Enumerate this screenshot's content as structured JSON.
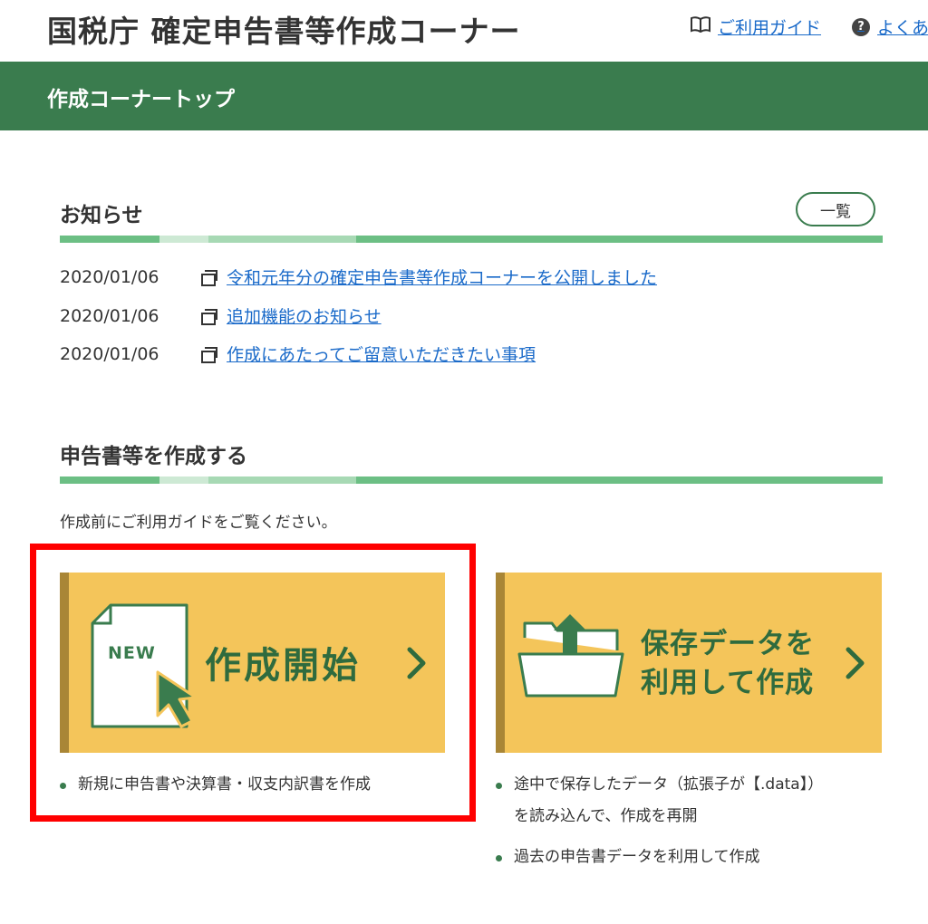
{
  "header": {
    "site_title": "国税庁 確定申告書等作成コーナー",
    "guide_link": "ご利用ガイド",
    "faq_link": "よくあ",
    "faq_icon_glyph": "?"
  },
  "nav_bar": {
    "title": "作成コーナートップ"
  },
  "news": {
    "title": "お知らせ",
    "list_button": "一覧",
    "items": [
      {
        "date": "2020/01/06",
        "text": "令和元年分の確定申告書等作成コーナーを公開しました"
      },
      {
        "date": "2020/01/06",
        "text": "追加機能のお知らせ"
      },
      {
        "date": "2020/01/06",
        "text": "作成にあたってご留意いただきたい事項"
      }
    ]
  },
  "create": {
    "title": "申告書等を作成する",
    "note": "作成前にご利用ガイドをご覧ください。",
    "new_card": {
      "badge": "NEW",
      "label": "作成開始",
      "bullets": [
        "新規に申告書や決算書・収支内訳書を作成"
      ]
    },
    "load_card": {
      "label_line1": "保存データを",
      "label_line2": "利用して作成",
      "bullets": [
        {
          "line1": "途中で保存したデータ（拡張子が【.data】）",
          "line2": "を読み込んで、作成を再開"
        },
        {
          "line1": "過去の申告書データを利用して作成"
        }
      ]
    }
  },
  "colors": {
    "brand_green": "#3a7c4e",
    "card_yellow": "#f4c55a",
    "link_blue": "#1a6ac9",
    "highlight_red": "#ff0000"
  }
}
